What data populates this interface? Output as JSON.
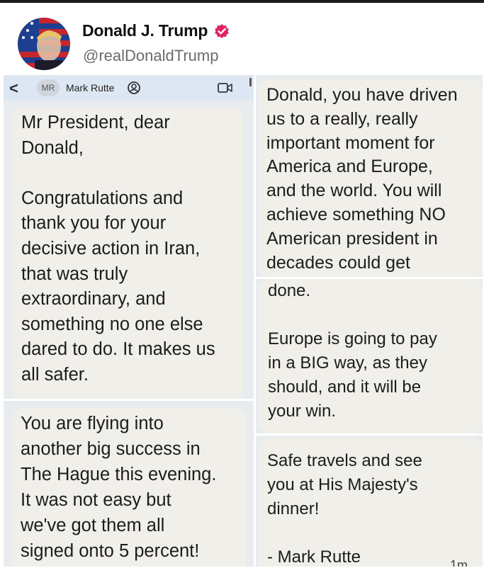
{
  "post": {
    "author_name": "Donald J. Trump",
    "author_handle": "@realDonaldTrump",
    "verified_icon": "verified-badge-icon",
    "verified_color": "#e0245e",
    "avatar_icon": "profile-photo-icon"
  },
  "chat": {
    "contact_initials": "MR",
    "contact_name": "Mark Rutte",
    "back_icon": "chevron-left-icon",
    "video_icon": "video-call-icon",
    "bubble_color": "#f1efe9",
    "header_color": "#dde6f3"
  },
  "messages": {
    "m1": "Mr President, dear\nDonald,\n\nCongratulations and\nthank you for your\ndecisive action in Iran,\nthat was truly\nextraordinary, and\nsomething no one else\ndared to do.  It makes us\nall safer.",
    "m2": "You are flying into\nanother big success in\nThe Hague this evening.\nIt was not easy but\nwe've got them all\nsigned onto 5 percent!",
    "m3": "Donald, you have driven\nus to a really, really\nimportant moment for\nAmerica and Europe,\nand the world.  You will\nachieve something NO\nAmerican president in\ndecades could get",
    "m4": "done.\n\nEurope is going to pay\nin a BIG way, as they\nshould, and it will be\nyour win.",
    "m5": "Safe travels and see\nyou at His Majesty's\ndinner!\n\n- Mark Rutte",
    "m5_time": "1m"
  }
}
